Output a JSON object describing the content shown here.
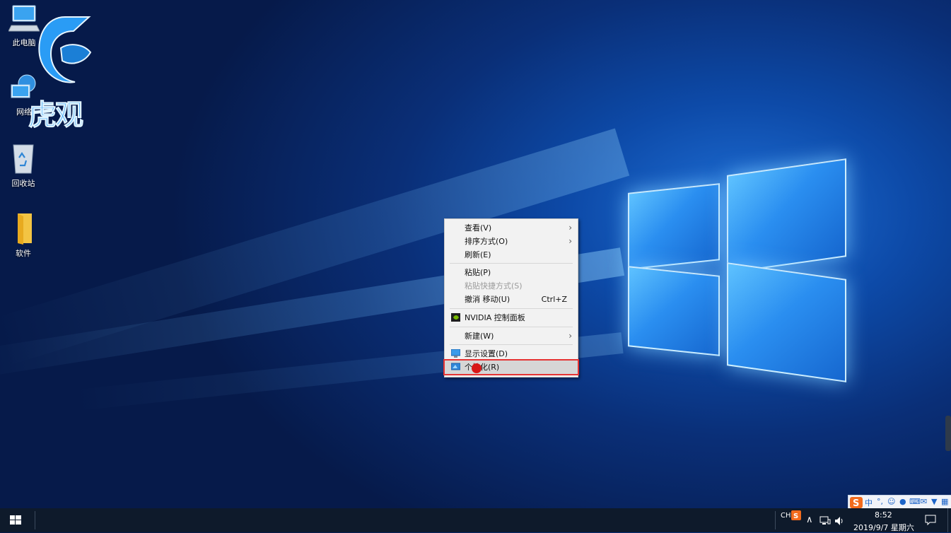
{
  "desktop": {
    "icons": [
      {
        "label": "此电脑"
      },
      {
        "label": "网络"
      },
      {
        "label": "回收站"
      },
      {
        "label": "软件"
      }
    ],
    "watermark": {
      "text": "虎观"
    }
  },
  "context_menu": {
    "items": [
      {
        "label": "查看(V)",
        "has_submenu": true
      },
      {
        "label": "排序方式(O)",
        "has_submenu": true
      },
      {
        "label": "刷新(E)"
      },
      {
        "label": "粘贴(P)"
      },
      {
        "label": "粘贴快捷方式(S)",
        "disabled": true
      },
      {
        "label": "撤消 移动(U)",
        "shortcut": "Ctrl+Z"
      },
      {
        "label": "NVIDIA 控制面板",
        "icon": "nvidia-icon"
      },
      {
        "label": "新建(W)",
        "has_submenu": true
      },
      {
        "label": "显示设置(D)",
        "icon": "display-settings-icon"
      },
      {
        "label": "个性化(R)",
        "icon": "personalize-icon",
        "highlighted": true
      }
    ],
    "highlight_color": "#e53333"
  },
  "ime_bar": {
    "mode": "中",
    "items": [
      "中",
      "°,",
      "☺",
      "🎤",
      "⌨",
      "✉",
      "👕",
      "▦"
    ]
  },
  "taskbar": {
    "language": "CH",
    "time": "8:52",
    "date": "2019/9/7 星期六"
  },
  "colors": {
    "taskbar": "#0e1a2b",
    "menu_bg": "#f2f2f2",
    "ime_brand": "#f26b1d"
  }
}
